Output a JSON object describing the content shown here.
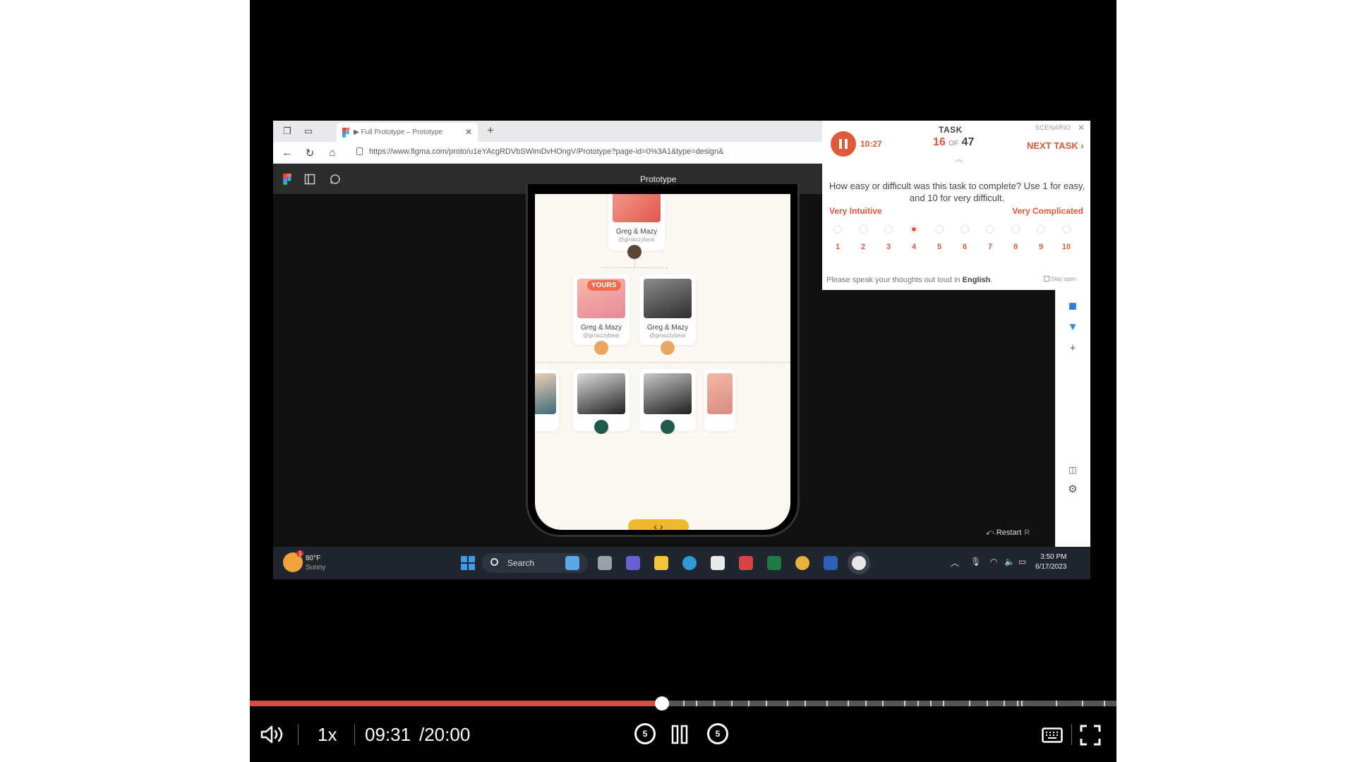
{
  "browser": {
    "tab_title": "▶ Full Prototype – Prototype",
    "url": "https://www.figma.com/proto/u1eYAcgRDVbSWimDvHOngV/Prototype?page-id=0%3A1&type=design&",
    "figma_title": "Prototype"
  },
  "phone": {
    "top_card": {
      "name": "Greg & Mazy",
      "handle": "@gmazzybear"
    },
    "left_card": {
      "badge": "YOURS",
      "name": "Greg & Mazy",
      "handle": "@gmazzybear"
    },
    "right_card": {
      "name": "Greg & Mazy",
      "handle": "@gmazzybear"
    }
  },
  "task": {
    "timer": "10:27",
    "label": "TASK",
    "current": "16",
    "of": "OF",
    "total": "47",
    "scenario": "SCENARIO",
    "next": "NEXT TASK ›",
    "question": "How easy or difficult was this task to complete? Use 1 for easy, and 10 for very difficult.",
    "low_label": "Very Intuitive",
    "high_label": "Very Complicated",
    "scale": [
      "1",
      "2",
      "3",
      "4",
      "5",
      "6",
      "7",
      "8",
      "9",
      "10"
    ],
    "selected_rating": 4,
    "speak_prefix": "Please speak your thoughts out loud in ",
    "speak_lang": "English",
    "speak_suffix": ".",
    "stay_open": "Stay open",
    "restart": "Restart",
    "restart_key": "R"
  },
  "taskbar": {
    "weather_badge": "1",
    "temp": "80°F",
    "condition": "Sunny",
    "search": "Search",
    "time": "3:50 PM",
    "date": "6/17/2023"
  },
  "player": {
    "speed": "1x",
    "current_time": "09:31",
    "duration": "/20:00",
    "progress_fraction": 0.4758,
    "skip_seconds": "5",
    "accent": "#d94a3f"
  }
}
